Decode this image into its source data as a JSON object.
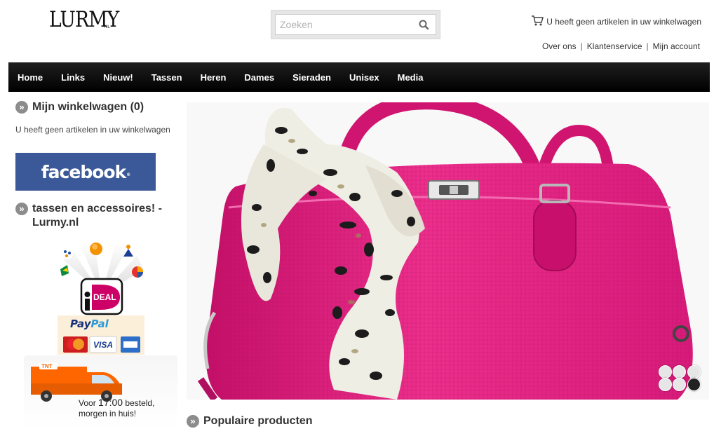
{
  "header": {
    "logo_text": "LURMY",
    "logo_tld": "NL",
    "search_placeholder": "Zoeken",
    "cart_text": "U heeft geen artikelen in uw winkelwagen",
    "top_links": [
      "Over ons",
      "Klantenservice",
      "Mijn account"
    ]
  },
  "nav": {
    "items": [
      "Home",
      "Links",
      "Nieuw!",
      "Tassen",
      "Heren",
      "Dames",
      "Sieraden",
      "Unisex",
      "Media"
    ]
  },
  "sidebar": {
    "cart_title": "Mijn winkelwagen (0)",
    "cart_empty_text": "U heeft geen artikelen in uw winkelwagen",
    "facebook_label": "facebook",
    "facebook_reg": "®",
    "shop_title": "tassen en accessoires! - Lurmy.nl",
    "ideal_text": "iDEAL",
    "paypal_text": "PayPal",
    "card_labels": [
      "VISA"
    ],
    "tnt_line1_prefix": "Voor ",
    "tnt_time": "17:00",
    "tnt_line1_suffix": " besteld,",
    "tnt_line2": "morgen in huis!",
    "tnt_logo": "TNT"
  },
  "main": {
    "popular_title": "Populaire producten",
    "slider": {
      "slide_count": 6,
      "active_index": 5
    }
  },
  "colors": {
    "nav_bg": "#000000",
    "bag": "#e0157a",
    "facebook": "#3b5998"
  }
}
